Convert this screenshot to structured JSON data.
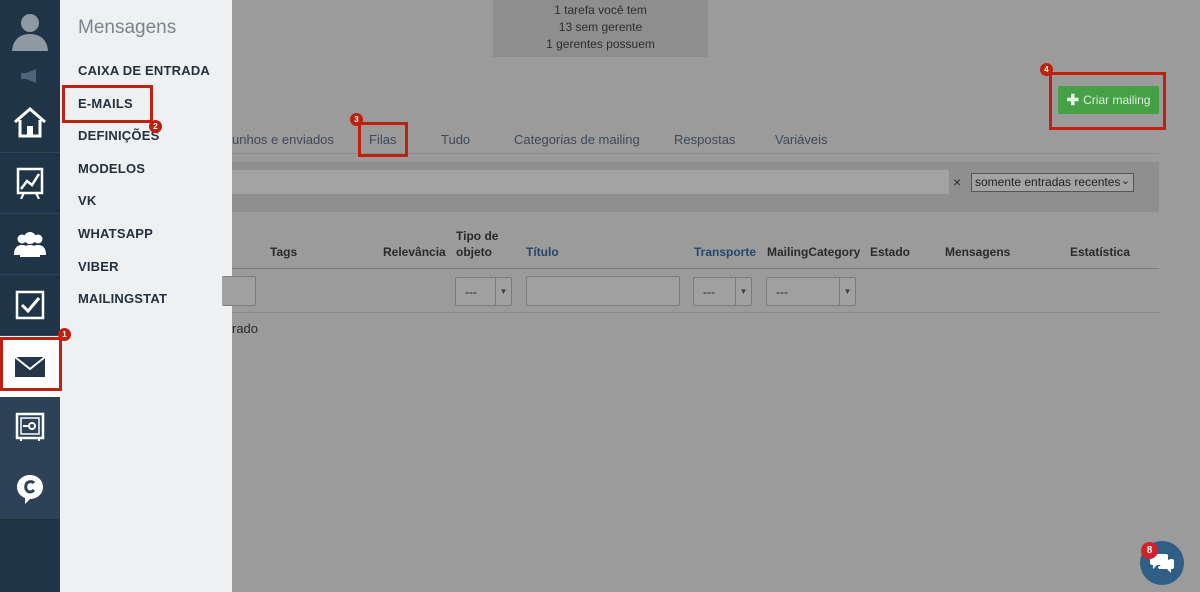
{
  "submenu": {
    "title": "Mensagens",
    "items": [
      {
        "label": "CAIXA DE ENTRADA"
      },
      {
        "label": "E-MAILS"
      },
      {
        "label": "DEFINIÇÕES"
      },
      {
        "label": "MODELOS"
      },
      {
        "label": "VK"
      },
      {
        "label": "WHATSAPP"
      },
      {
        "label": "VIBER"
      },
      {
        "label": "MAILINGSTAT"
      }
    ]
  },
  "rail": {
    "icons": [
      "user-avatar-icon",
      "megaphone-icon",
      "home-icon",
      "chart-icon",
      "people-icon",
      "checkbox-icon",
      "envelope-icon",
      "safe-icon",
      "c-logo-icon"
    ]
  },
  "notice": {
    "line1": "1 tarefa você tem",
    "line2": "13 sem gerente",
    "line3": "1 gerentes possuem"
  },
  "actions": {
    "create_label": "Criar mailing"
  },
  "tabs": [
    {
      "label": "unhos e enviados"
    },
    {
      "label": "Filas"
    },
    {
      "label": "Tudo"
    },
    {
      "label": "Categorias de mailing"
    },
    {
      "label": "Respostas"
    },
    {
      "label": "Variáveis"
    }
  ],
  "filter": {
    "clear": "×",
    "period_value": "somente entradas recentes"
  },
  "table": {
    "columns": [
      {
        "label": "Tags"
      },
      {
        "label": "Relevância"
      },
      {
        "label": "Tipo de objeto"
      },
      {
        "label": "Título"
      },
      {
        "label": "Transporte"
      },
      {
        "label": "MailingCategory"
      },
      {
        "label": "Estado"
      },
      {
        "label": "Mensagens"
      },
      {
        "label": "Estatística"
      }
    ],
    "select_placeholder": "---",
    "empty_text": "rado"
  },
  "annotations": {
    "b1": "1",
    "b2": "2",
    "b3": "3",
    "b4": "4"
  },
  "chat": {
    "badge": "8"
  },
  "colors": {
    "rail": "#203448",
    "highlight": "#c0200f",
    "create_button": "#45a046"
  }
}
